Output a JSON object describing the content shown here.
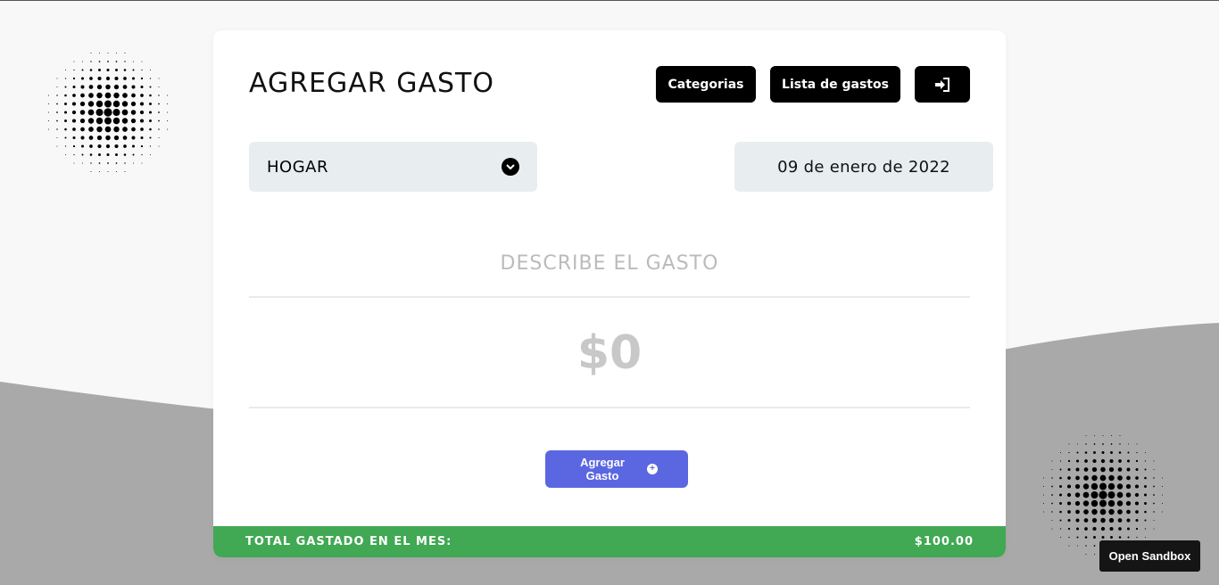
{
  "header": {
    "title": "AGREGAR GASTO",
    "categories_button": "Categorias",
    "expense_list_button": "Lista de gastos",
    "logout_icon": "sign-in-icon"
  },
  "form": {
    "category_selected": "HOGAR",
    "category_icon": "chevron-down-circle-icon",
    "date_value": "09 de enero de 2022",
    "description_placeholder": "DESCRIBE EL GASTO",
    "amount_placeholder": "$0",
    "submit_label": "Agregar Gasto",
    "submit_icon": "plus-circle-icon"
  },
  "footer": {
    "total_label": "TOTAL GASTADO EN EL MES:",
    "total_value": "$100.00"
  },
  "sandbox": {
    "label": "Open Sandbox"
  },
  "colors": {
    "accent": "#5b67e0",
    "total_bar": "#41a853",
    "field_bg": "#e8eef0",
    "wave": "#a9a9a9"
  }
}
